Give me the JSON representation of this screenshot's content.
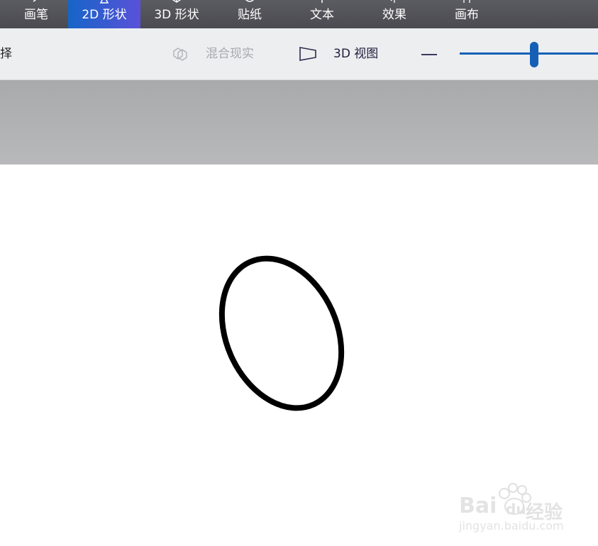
{
  "tabs": [
    {
      "label": "画笔",
      "icon": "brush-icon"
    },
    {
      "label": "2D 形状",
      "icon": "triangle-icon",
      "active": true
    },
    {
      "label": "3D 形状",
      "icon": "cube-icon"
    },
    {
      "label": "贴纸",
      "icon": "sticker-icon"
    },
    {
      "label": "文本",
      "icon": "text-icon"
    },
    {
      "label": "效果",
      "icon": "sun-icon"
    },
    {
      "label": "画布",
      "icon": "canvas-icon"
    }
  ],
  "toolbar": {
    "select_label": "择",
    "mixed_reality_label": "混合现实",
    "view3d_label": "3D 视图",
    "zoom_level": 0.53
  },
  "watermark": {
    "brand_text": "Bai",
    "brand_text2": "du",
    "brand_cn": "经验",
    "url": "jingyan.baidu.com"
  },
  "colors": {
    "active_tab_start": "#1565c8",
    "active_tab_end": "#5a51d8",
    "accent": "#1560b6",
    "topbar": "#4f4f55"
  }
}
